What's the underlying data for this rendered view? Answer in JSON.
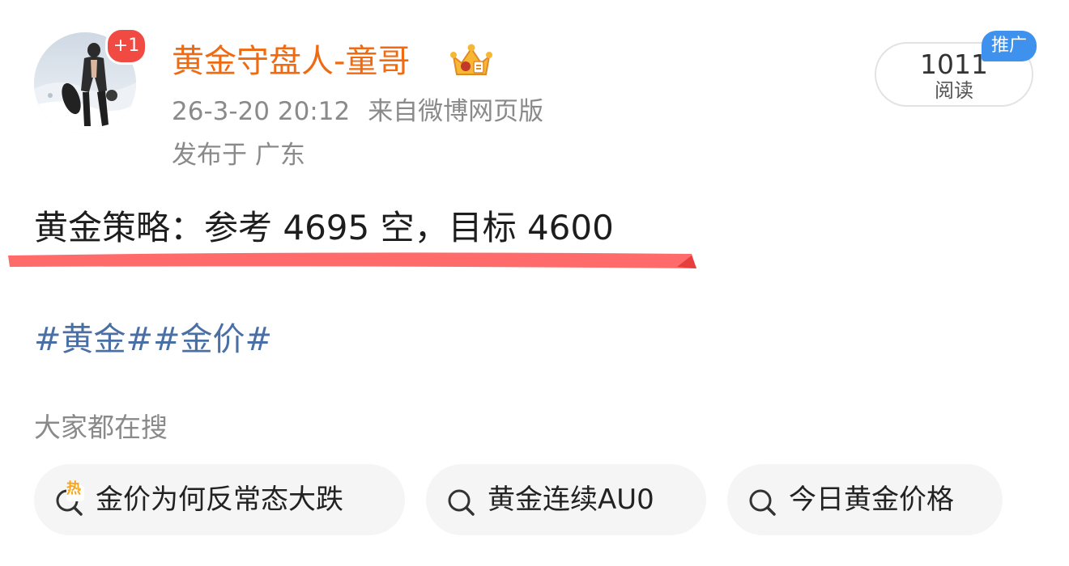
{
  "post": {
    "avatar_badge": "+1",
    "author_name": "黄金守盘人-童哥",
    "timestamp": "26-3-20 20:12",
    "source": "来自微博网页版",
    "location": "发布于 广东",
    "read_count": "1011",
    "read_label": "阅读",
    "promo_tag": "推广",
    "text": "黄金策略：参考 4695 空，目标 4600",
    "hashtags": "#黄金##金价#"
  },
  "search": {
    "title": "大家都在搜",
    "chips": [
      {
        "label": "金价为何反常态大跌",
        "hot_badge": "热"
      },
      {
        "label": "黄金连续AU0"
      },
      {
        "label": "今日黄金价格"
      }
    ]
  },
  "colors": {
    "author_name": "#f06a12",
    "hashtag": "#4a6fa5",
    "underline": "#ff6b6b",
    "avatar_badge": "#f04a43",
    "promo_tag": "#3f91ee",
    "hot_badge": "#f5a623"
  },
  "icons": [
    "crown-vip-icon",
    "search-icon",
    "hot-search-icon"
  ]
}
